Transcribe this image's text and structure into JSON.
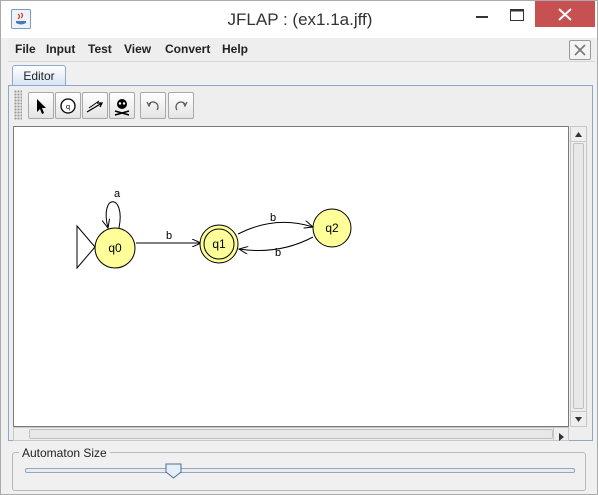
{
  "window": {
    "title": "JFLAP : (ex1.1a.jff)"
  },
  "menu": {
    "items": [
      "File",
      "Input",
      "Test",
      "View",
      "Convert",
      "Help"
    ]
  },
  "tabs": {
    "active": "Editor"
  },
  "automaton": {
    "states": [
      {
        "label": "q0",
        "initial": true,
        "final": false
      },
      {
        "label": "q1",
        "initial": false,
        "final": true
      },
      {
        "label": "q2",
        "initial": false,
        "final": false
      }
    ],
    "transitions": [
      {
        "from": "q0",
        "to": "q0",
        "symbol": "a"
      },
      {
        "from": "q0",
        "to": "q1",
        "symbol": "b"
      },
      {
        "from": "q1",
        "to": "q2",
        "symbol": "b"
      },
      {
        "from": "q2",
        "to": "q1",
        "symbol": "b"
      }
    ],
    "state_color": "#ffff99"
  },
  "size_panel": {
    "title": "Automaton Size",
    "slider_fraction": 0.27
  },
  "icons": [
    "app-icon",
    "minimize-icon",
    "maximize-icon",
    "close-icon",
    "pointer-icon",
    "state-icon",
    "transition-icon",
    "deleter-icon",
    "undo-icon",
    "redo-icon"
  ]
}
